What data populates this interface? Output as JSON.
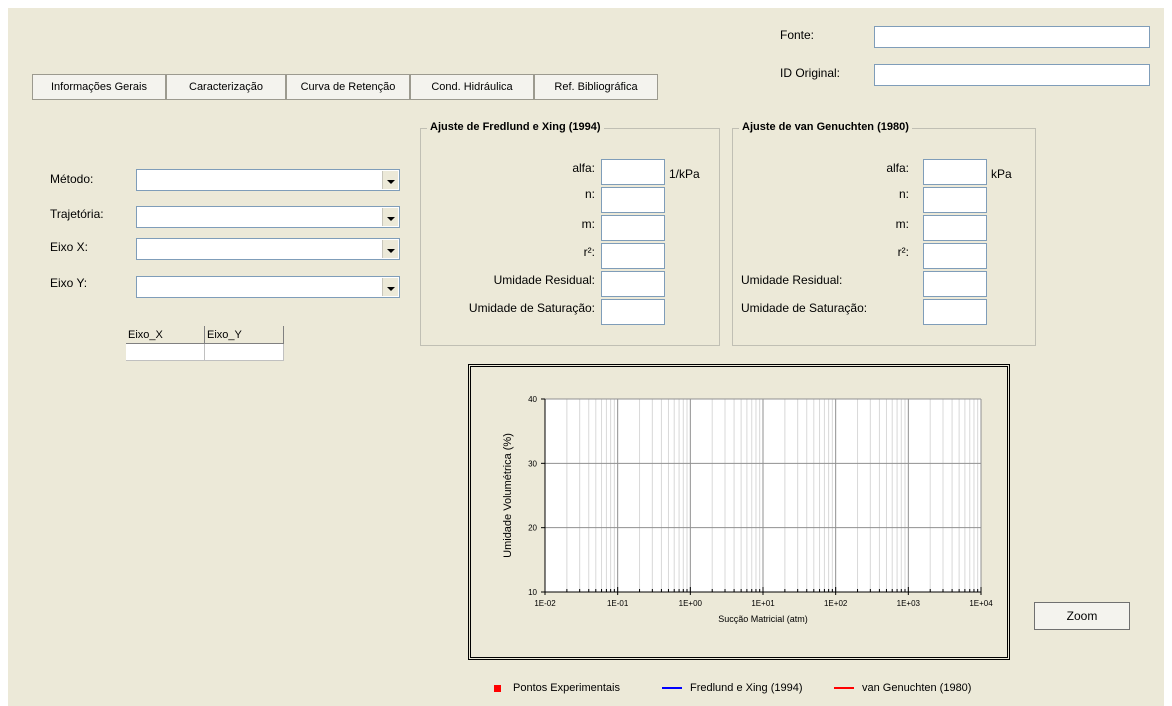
{
  "header": {
    "fonte_label": "Fonte:",
    "fonte_value": "",
    "id_label": "ID Original:",
    "id_value": ""
  },
  "tabs": [
    {
      "label": "Informações Gerais"
    },
    {
      "label": "Caracterização"
    },
    {
      "label": "Curva de Retenção"
    },
    {
      "label": "Cond. Hidráulica"
    },
    {
      "label": "Ref. Bibliográfica"
    }
  ],
  "left_form": {
    "metodo_label": "Método:",
    "metodo_value": "",
    "trajetoria_label": "Trajetória:",
    "trajetoria_value": "",
    "eixox_label": "Eixo X:",
    "eixox_value": "",
    "eixoy_label": "Eixo Y:",
    "eixoy_value": ""
  },
  "grid": {
    "columns": [
      "Eixo_X",
      "Eixo_Y"
    ],
    "rows": [
      [
        "",
        ""
      ]
    ]
  },
  "fredlund": {
    "title": "Ajuste de Fredlund e Xing (1994)",
    "alfa_label": "alfa:",
    "alfa_unit": "1/kPa",
    "n_label": "n:",
    "m_label": "m:",
    "r2_label": "r²:",
    "residual_label": "Umidade Residual:",
    "saturacao_label": "Umidade de Saturação:"
  },
  "genuchten": {
    "title": "Ajuste de van Genuchten (1980)",
    "alfa_label": "alfa:",
    "alfa_unit": "kPa",
    "n_label": "n:",
    "m_label": "m:",
    "r2_label": "r²:",
    "residual_label": "Umidade Residual:",
    "saturacao_label": "Umidade de Saturação:"
  },
  "chart_data": {
    "type": "scatter",
    "x_scale": "log",
    "xlim": [
      "1E-02",
      "1E+04"
    ],
    "ylim": [
      10,
      40
    ],
    "x_ticks": [
      "1E-02",
      "1E-01",
      "1E+00",
      "1E+01",
      "1E+02",
      "1E+03",
      "1E+04"
    ],
    "y_ticks": [
      10,
      20,
      30,
      40
    ],
    "xlabel": "Sucção Matricial (atm)",
    "ylabel": "Umidade Volumétrica (%)",
    "grid": true,
    "series": []
  },
  "zoom_label": "Zoom",
  "legend": [
    {
      "label": "Pontos Experimentais",
      "color": "#ff0000",
      "marker": "square"
    },
    {
      "label": "Fredlund e Xing (1994)",
      "color": "#0000ff",
      "marker": "line"
    },
    {
      "label": "van Genuchten (1980)",
      "color": "#ff0000",
      "marker": "line"
    }
  ]
}
